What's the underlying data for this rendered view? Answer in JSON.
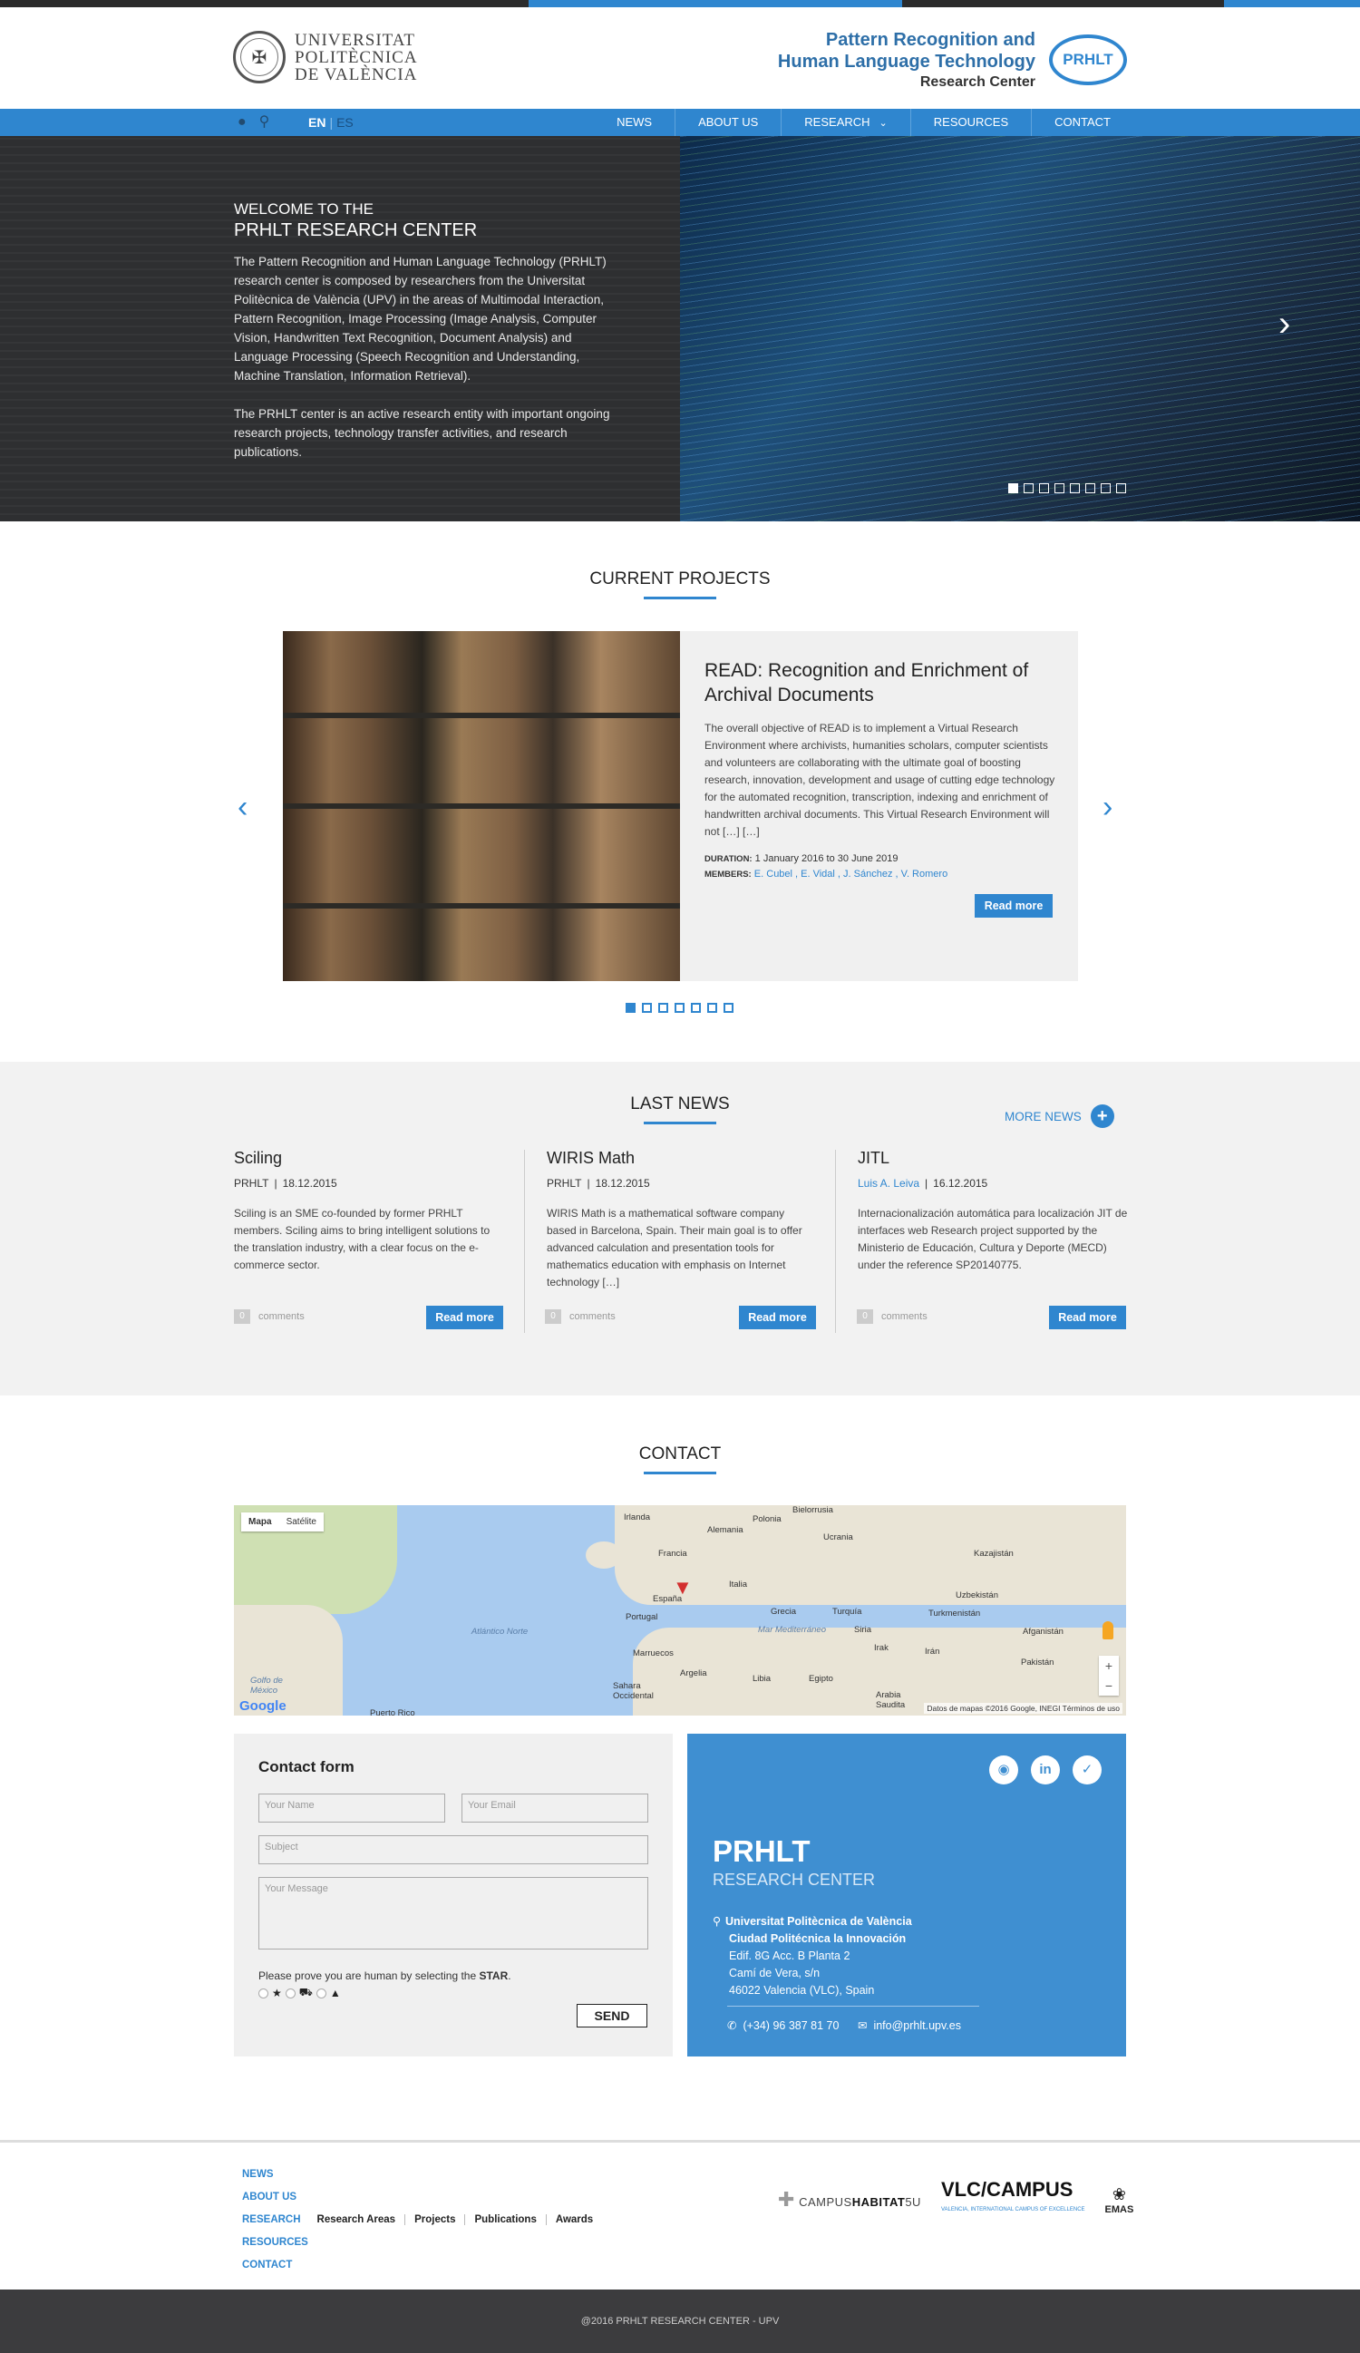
{
  "header": {
    "university_name": [
      "UNIVERSITAT",
      "POLITÈCNICA",
      "DE VALÈNCIA"
    ],
    "center_title_1": "Pattern Recognition and",
    "center_title_2": "Human Language Technology",
    "center_subtitle": "Research Center",
    "badge": "PRHLT"
  },
  "nav": {
    "lang_active": "EN",
    "lang_other": "ES",
    "items": [
      "NEWS",
      "ABOUT US",
      "RESEARCH",
      "RESOURCES",
      "CONTACT"
    ],
    "icons": [
      "user-icon",
      "search-icon"
    ]
  },
  "hero": {
    "welcome": "WELCOME TO THE",
    "title": "PRHLT RESEARCH CENTER",
    "p1": "The Pattern Recognition and Human Language Technology (PRHLT) research center is composed by researchers from the Universitat Politècnica de València (UPV) in the areas of Multimodal Interaction, Pattern Recognition, Image Processing (Image Analysis, Computer Vision, Handwritten Text Recognition, Document Analysis) and Language Processing (Speech Recognition and Understanding, Machine Translation, Information Retrieval).",
    "p2": "The PRHLT center is an active research entity with important ongoing research projects, technology transfer activities, and research publications.",
    "slide_count": 8,
    "active_slide": 1
  },
  "projects": {
    "section_title": "CURRENT PROJECTS",
    "title": "READ: Recognition and Enrichment of Archival Documents",
    "description": "The overall objective of READ is to implement a Virtual Research Environment where archivists, humanities scholars, computer scientists and volunteers are collaborating with the ultimate goal of boosting research, innovation, development and usage of cutting edge technology for the automated recognition, transcription, indexing and enrichment of handwritten archival documents. This Virtual Research Environment will not […] […]",
    "duration_label": "DURATION:",
    "duration": "1 January 2016 to 30 June 2019",
    "members_label": "MEMBERS:",
    "members": "E. Cubel , E. Vidal , J. Sánchez , V. Romero",
    "read_more": "Read more",
    "slide_count": 7,
    "active_slide": 1
  },
  "news": {
    "section_title": "LAST NEWS",
    "more": "MORE NEWS",
    "items": [
      {
        "title": "Sciling",
        "author": "PRHLT",
        "date": "18.12.2015",
        "text": "Sciling is an SME co-founded by former PRHLT members. Sciling aims to bring intelligent solutions to the translation industry, with a clear focus on the e-commerce sector.",
        "comments": "0",
        "comments_label": "comments",
        "read_more": "Read more"
      },
      {
        "title": "WIRIS Math",
        "author": "PRHLT",
        "date": "18.12.2015",
        "text": "WIRIS Math is a mathematical software company based in Barcelona, Spain. Their main goal is to offer advanced calculation and presentation tools for mathematics education with emphasis on Internet technology […]",
        "comments": "0",
        "comments_label": "comments",
        "read_more": "Read more"
      },
      {
        "title": "JITL",
        "author": "Luis A. Leiva",
        "date": "16.12.2015",
        "text": "Internacionalización automática para localización JIT de interfaces web Research project supported by the Ministerio de Educación, Cultura y Deporte (MECD) under the reference SP20140775.",
        "comments": "0",
        "comments_label": "comments",
        "read_more": "Read more"
      }
    ]
  },
  "contact": {
    "section_title": "CONTACT",
    "map": {
      "tab_map": "Mapa",
      "tab_satellite": "Satélite",
      "labels": [
        "Irlanda",
        "Polonia",
        "Bielorrusia",
        "Alemania",
        "Ucrania",
        "Francia",
        "Kazajistán",
        "Italia",
        "España",
        "Portugal",
        "Grecia",
        "Turquía",
        "Uzbekistán",
        "Turkmenistán",
        "Atlántico Norte",
        "Mar Mediterráneo",
        "Siria",
        "Irak",
        "Irán",
        "Afganistán",
        "Pakistán",
        "Marruecos",
        "Argelia",
        "Libia",
        "Egipto",
        "Arabia Saudita",
        "Sahara Occidental",
        "Golfo de México",
        "Puerto Rico"
      ],
      "google": "Google",
      "credits": "Datos de mapas ©2016 Google, INEGI    Términos de uso"
    },
    "form": {
      "title": "Contact form",
      "name_placeholder": "Your Name",
      "email_placeholder": "Your Email",
      "subject_placeholder": "Subject",
      "message_placeholder": "Your Message",
      "captcha_prefix": "Please prove you are human by selecting the ",
      "captcha_target": "STAR",
      "captcha_suffix": ".",
      "send": "SEND"
    },
    "info": {
      "name": "PRHLT",
      "subtitle": "RESEARCH CENTER",
      "addr1": "Universitat Politècnica de València",
      "addr2": "Ciudad Politécnica la Innovación",
      "addr3": "Edif. 8G Acc. B Planta 2",
      "addr4": "Camí de Vera, s/n",
      "addr5": "46022 Valencia (VLC), Spain",
      "phone": "(+34) 96 387 81 70",
      "email": "info@prhlt.upv.es",
      "social": [
        "github-icon",
        "linkedin-icon",
        "twitter-icon"
      ]
    }
  },
  "footer": {
    "links": [
      "NEWS",
      "ABOUT US",
      "RESEARCH",
      "RESOURCES",
      "CONTACT"
    ],
    "research_sub": [
      "Research Areas",
      "Projects",
      "Publications",
      "Awards"
    ],
    "logo1_a": "CAMPUS",
    "logo1_b": "HABITAT",
    "logo1_c": "5U",
    "logo2": "VLC/CAMPUS",
    "logo2_sub": "VALENCIA, INTERNATIONAL CAMPUS OF EXCELLENCE",
    "logo3": "EMAS",
    "copyright": "@2016 PRHLT RESEARCH CENTER - UPV"
  },
  "colors": {
    "accent": "#2f86cf",
    "contact_panel": "#3f8fd1",
    "footer_bar": "#3c3c3e"
  }
}
